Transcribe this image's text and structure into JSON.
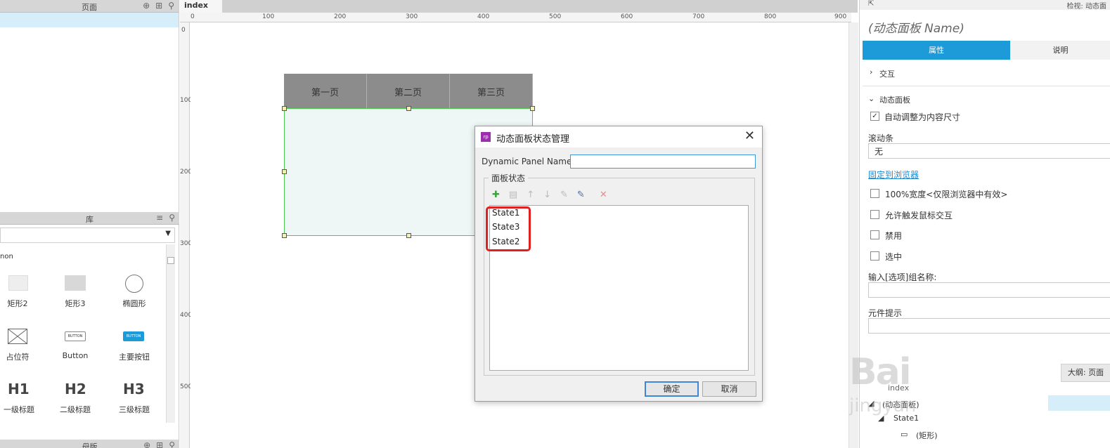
{
  "pages_pane": {
    "title": "页面"
  },
  "library_pane": {
    "title": "库",
    "section": "non",
    "widgets": [
      {
        "label": "矩形2"
      },
      {
        "label": "矩形3"
      },
      {
        "label": "椭圆形"
      },
      {
        "label": "占位符"
      },
      {
        "label": "Button"
      },
      {
        "label": "主要按钮"
      },
      {
        "label": "一级标题",
        "glyph": "H1"
      },
      {
        "label": "二级标题",
        "glyph": "H2"
      },
      {
        "label": "三级标题",
        "glyph": "H3"
      }
    ],
    "button_glyph": "BUTTON"
  },
  "masters_pane": {
    "title": "母版"
  },
  "editor": {
    "tab": "index",
    "ruler_h": [
      "0",
      "100",
      "200",
      "300",
      "400",
      "500",
      "600",
      "700",
      "800",
      "900"
    ],
    "ruler_v": [
      "0",
      "100",
      "200",
      "300",
      "400",
      "500"
    ],
    "menu_items": [
      "第一页",
      "第二页",
      "第三页"
    ]
  },
  "dialog": {
    "title": "动态面板状态管理",
    "name_label": "Dynamic Panel Name:",
    "name_value": "",
    "group_title": "面板状态",
    "states": [
      "State1",
      "State3",
      "State2"
    ],
    "ok_label": "确定",
    "cancel_label": "取消"
  },
  "inspector": {
    "header": "检视: 动态面",
    "panel_name": "(动态面板 Name)",
    "tab_properties": "属性",
    "tab_notes": "说明",
    "interactions": "交互",
    "section_dynamic": "动态面板",
    "auto_fit": "自动调整为内容尺寸",
    "scrollbar_label": "滚动条",
    "scrollbar_value": "无",
    "pin_link": "固定到浏览器",
    "opt_100_width": "100%宽度<仅限浏览器中有效>",
    "opt_mouse": "允许触发鼠标交互",
    "opt_disabled": "禁用",
    "opt_selected": "选中",
    "group_name_label": "输入[选项]组名称:",
    "tooltip_label": "元件提示"
  },
  "outline": {
    "tab": "大纲: 页面",
    "items": [
      "index",
      "(动态面板)",
      "State1",
      "(矩形)"
    ]
  },
  "watermark": {
    "main": "Bai",
    "sub": "jingyan"
  }
}
